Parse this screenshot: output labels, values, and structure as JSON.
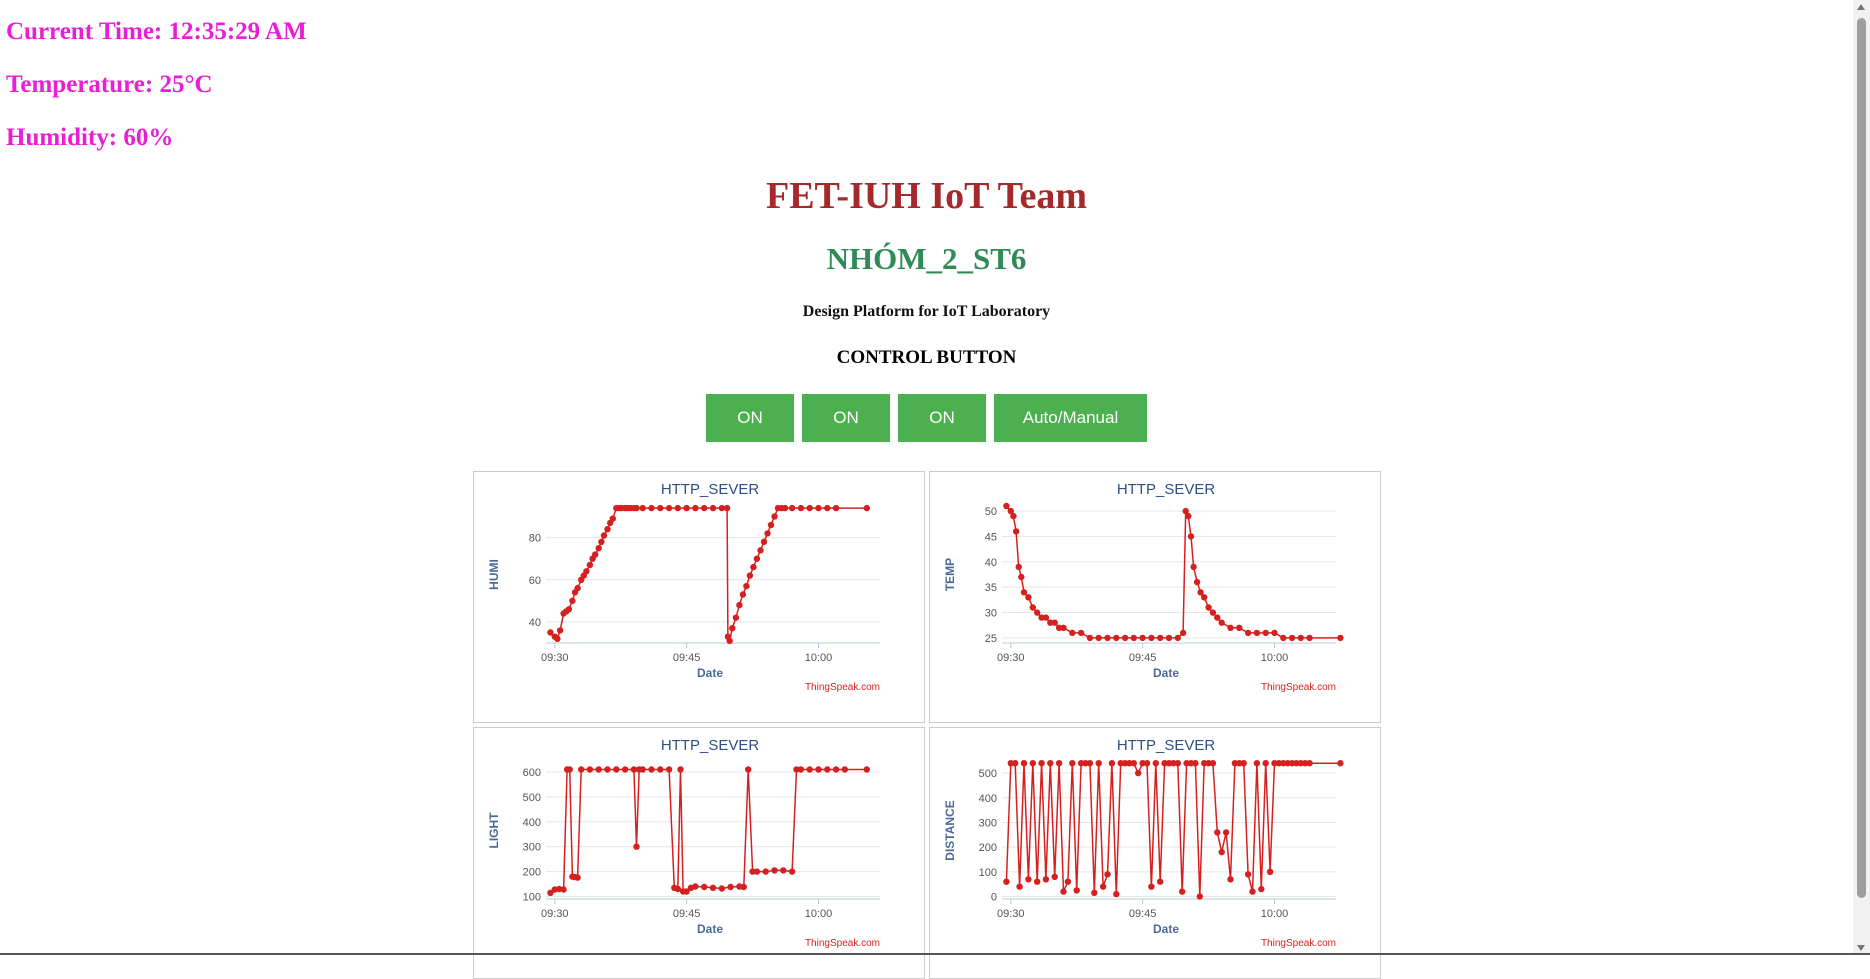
{
  "status": {
    "time": "Current Time: 12:35:29 AM",
    "temperature": "Temperature: 25°C",
    "humidity": "Humidity: 60%"
  },
  "header": {
    "team": "FET-IUH IoT Team",
    "group": "NHÓM_2_ST6",
    "description": "Design Platform for IoT Laboratory",
    "control_title": "CONTROL BUTTON"
  },
  "buttons": [
    {
      "label": "ON"
    },
    {
      "label": "ON"
    },
    {
      "label": "ON"
    },
    {
      "label": "Auto/Manual"
    }
  ],
  "colors": {
    "status": "#e91ed6",
    "team": "#a5282a",
    "group": "#2e8b57",
    "button": "#4caf50",
    "series": "#d62020"
  },
  "chart_data": [
    {
      "type": "line",
      "title": "HTTP_SEVER",
      "xlabel": "Date",
      "ylabel": "HUMI",
      "credit": "ThingSpeak.com",
      "x_ticks": [
        "09:30",
        "09:45",
        "10:00"
      ],
      "y_ticks": [
        40,
        60,
        80
      ],
      "xlim": [
        -1,
        37
      ],
      "ylim": [
        30,
        95
      ],
      "grid": true,
      "x": [
        -0.5,
        0,
        0.3,
        0.6,
        1,
        1.3,
        1.6,
        2,
        2.3,
        2.6,
        3,
        3.3,
        3.6,
        4,
        4.3,
        4.6,
        5,
        5.3,
        5.6,
        6,
        6.3,
        6.6,
        7,
        7.3,
        7.6,
        8,
        8.3,
        8.6,
        9,
        9.3,
        10,
        11,
        12,
        13,
        14,
        15,
        16,
        17,
        18,
        19,
        19.6,
        19.7,
        19.9,
        20.2,
        20.6,
        21,
        21.4,
        21.8,
        22.2,
        22.6,
        23,
        23.4,
        23.8,
        24.2,
        24.6,
        25,
        25.4,
        25.8,
        26.2,
        27,
        28,
        29,
        30,
        31,
        32,
        35.5
      ],
      "y": [
        35,
        33,
        32,
        36,
        44,
        45,
        46,
        50,
        54,
        56,
        60,
        62,
        64,
        67,
        70,
        72,
        75,
        78,
        81,
        84,
        87,
        89,
        94,
        94,
        94,
        94,
        94,
        94,
        94,
        94,
        94,
        94,
        94,
        94,
        94,
        94,
        94,
        94,
        94,
        94,
        94,
        33,
        31,
        37,
        42,
        48,
        53,
        57,
        62,
        66,
        70,
        74,
        78,
        82,
        86,
        90,
        94,
        94,
        94,
        94,
        94,
        94,
        94,
        94,
        94,
        94
      ]
    },
    {
      "type": "line",
      "title": "HTTP_SEVER",
      "xlabel": "Date",
      "ylabel": "TEMP",
      "credit": "ThingSpeak.com",
      "x_ticks": [
        "09:30",
        "09:45",
        "10:00"
      ],
      "y_ticks": [
        25,
        30,
        35,
        40,
        45,
        50
      ],
      "xlim": [
        -1,
        37
      ],
      "ylim": [
        24,
        51
      ],
      "grid": true,
      "x": [
        -0.5,
        0,
        0.3,
        0.6,
        0.9,
        1.2,
        1.5,
        2,
        2.5,
        3,
        3.5,
        4,
        4.5,
        5,
        5.5,
        6,
        7,
        8,
        9,
        10,
        11,
        12,
        13,
        14,
        15,
        16,
        17,
        18,
        19,
        19.6,
        19.9,
        20.2,
        20.5,
        20.8,
        21.2,
        21.6,
        22,
        22.5,
        23,
        23.5,
        24,
        25,
        26,
        27,
        28,
        29,
        30,
        31,
        32,
        33,
        34,
        37.5
      ],
      "y": [
        51,
        50,
        49,
        46,
        39,
        37,
        34,
        33,
        31,
        30,
        29,
        29,
        28,
        28,
        27,
        27,
        26,
        26,
        25,
        25,
        25,
        25,
        25,
        25,
        25,
        25,
        25,
        25,
        25,
        26,
        50,
        49,
        45,
        39,
        36,
        34,
        33,
        31,
        30,
        29,
        28,
        27,
        27,
        26,
        26,
        26,
        26,
        25,
        25,
        25,
        25,
        25
      ]
    },
    {
      "type": "line",
      "title": "HTTP_SEVER",
      "xlabel": "Date",
      "ylabel": "LIGHT",
      "credit": "ThingSpeak.com",
      "x_ticks": [
        "09:30",
        "09:45",
        "10:00"
      ],
      "y_ticks": [
        100,
        200,
        300,
        400,
        500,
        600
      ],
      "xlim": [
        -1,
        37
      ],
      "ylim": [
        90,
        640
      ],
      "grid": true,
      "x": [
        -0.5,
        0,
        0.5,
        1,
        1.4,
        1.7,
        2,
        2.3,
        2.6,
        3,
        4,
        5,
        6,
        7,
        8,
        9,
        9.3,
        9.6,
        10,
        11,
        12,
        13,
        13.6,
        14,
        14.3,
        14.6,
        15,
        15.5,
        16,
        17,
        18,
        19,
        20,
        21,
        21.5,
        22,
        22.5,
        23,
        24,
        25,
        26,
        27,
        27.5,
        28,
        29,
        30,
        31,
        32,
        33,
        35.5
      ],
      "y": [
        115,
        128,
        130,
        128,
        610,
        610,
        180,
        178,
        176,
        610,
        610,
        610,
        610,
        610,
        610,
        610,
        300,
        610,
        610,
        610,
        610,
        610,
        135,
        130,
        610,
        120,
        120,
        135,
        140,
        138,
        135,
        132,
        138,
        140,
        138,
        610,
        200,
        200,
        200,
        205,
        205,
        200,
        610,
        610,
        610,
        610,
        610,
        610,
        610,
        610
      ]
    },
    {
      "type": "line",
      "title": "HTTP_SEVER",
      "xlabel": "Date",
      "ylabel": "DISTANCE",
      "credit": "ThingSpeak.com",
      "x_ticks": [
        "09:30",
        "09:45",
        "10:00"
      ],
      "y_ticks": [
        0,
        100,
        200,
        300,
        400,
        500
      ],
      "xlim": [
        -1,
        37
      ],
      "ylim": [
        -10,
        545
      ],
      "grid": true,
      "x": [
        -0.5,
        0,
        0.5,
        1,
        1.5,
        2,
        2.5,
        3,
        3.5,
        4,
        4.5,
        5,
        5.5,
        6,
        6.5,
        7,
        7.5,
        8,
        8.5,
        9,
        9.5,
        10,
        10.5,
        11,
        11.5,
        12,
        12.5,
        13,
        13.5,
        14,
        14.5,
        15,
        15.5,
        16,
        16.5,
        17,
        17.5,
        18,
        18.5,
        19,
        19.5,
        20,
        20.5,
        21,
        21.5,
        22,
        22.5,
        23,
        23.5,
        24,
        24.5,
        25,
        25.5,
        26,
        26.5,
        27,
        27.5,
        28,
        28.5,
        29,
        29.5,
        30,
        30.5,
        31,
        31.5,
        32,
        32.5,
        33,
        33.5,
        34,
        37.5
      ],
      "y": [
        60,
        540,
        540,
        40,
        540,
        70,
        540,
        60,
        540,
        70,
        540,
        80,
        540,
        20,
        60,
        540,
        25,
        540,
        540,
        540,
        15,
        540,
        40,
        90,
        540,
        10,
        540,
        540,
        540,
        540,
        500,
        540,
        540,
        40,
        540,
        60,
        540,
        540,
        540,
        540,
        20,
        540,
        540,
        540,
        0,
        540,
        540,
        540,
        260,
        180,
        260,
        70,
        540,
        540,
        540,
        90,
        20,
        540,
        30,
        540,
        100,
        540,
        540,
        540,
        540,
        540,
        540,
        540,
        540,
        540,
        540
      ]
    }
  ]
}
